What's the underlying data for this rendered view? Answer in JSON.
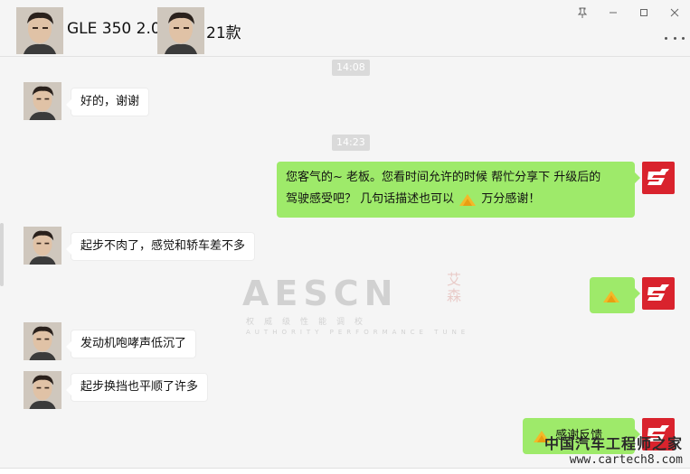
{
  "header": {
    "title_left": "GLE 350 2.0",
    "title_right": "21款"
  },
  "window_controls": [
    "pin-icon",
    "minimize-icon",
    "maximize-icon",
    "close-icon"
  ],
  "messages": {
    "t1": "14:08",
    "m1": "好的，谢谢",
    "t2": "14:23",
    "m2_line1": "您客气的~  老板。您看时间允许的时候 帮忙分享下 升级后的",
    "m2_line2a": "驾驶感受吧？ 几句话描述也可以",
    "m2_line2b": " 万分感谢！",
    "m3": "起步不肉了，感觉和轿车差不多",
    "m5": "发动机咆哮声低沉了",
    "m6": "起步换挡也平顺了许多",
    "m7": "感谢反馈"
  },
  "watermark": {
    "letters": "AESCN",
    "cn": "艾森",
    "sub": "权威级性能调校",
    "sub2": "AUTHORITY PERFORMANCE TUNE"
  },
  "corner_watermark": {
    "line1": "中国汽车工程师之家",
    "line2": "www.cartech8.com"
  },
  "colors": {
    "outgoing_bubble": "#9eea6a",
    "incoming_bubble": "#ffffff",
    "time_badge": "#dadada",
    "brand_red": "#d9232d"
  }
}
